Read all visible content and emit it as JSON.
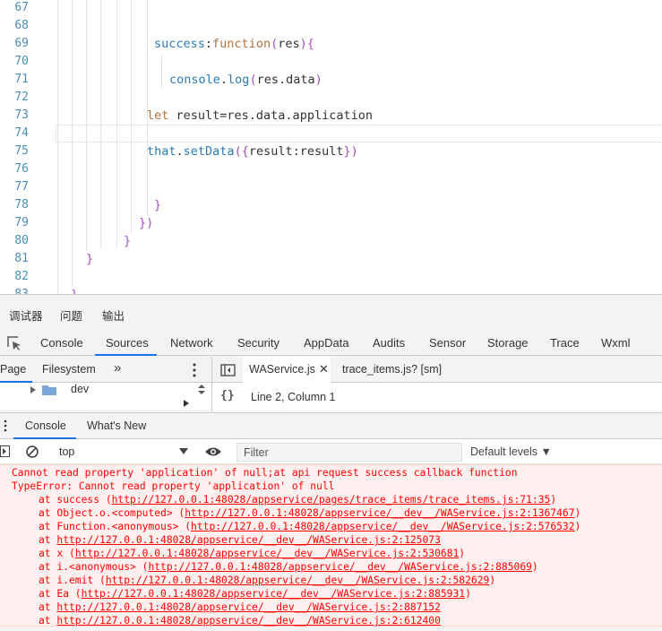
{
  "editor": {
    "lines": [
      {
        "num": "67",
        "code": ""
      },
      {
        "num": "68",
        "code": ""
      },
      {
        "num": "69",
        "code": "success:function(res){"
      },
      {
        "num": "70",
        "code": ""
      },
      {
        "num": "71",
        "code": "console.log(res.data)"
      },
      {
        "num": "72",
        "code": ""
      },
      {
        "num": "73",
        "code": "let result=res.data.application"
      },
      {
        "num": "74",
        "code": ""
      },
      {
        "num": "75",
        "code": "that.setData({result:result})"
      },
      {
        "num": "76",
        "code": ""
      },
      {
        "num": "77",
        "code": ""
      },
      {
        "num": "78",
        "code": "}"
      },
      {
        "num": "79",
        "code": "})"
      },
      {
        "num": "80",
        "code": "}"
      },
      {
        "num": "81",
        "code": "}"
      },
      {
        "num": "82",
        "code": ""
      },
      {
        "num": "83",
        "code": "}"
      }
    ]
  },
  "devtools": {
    "main_tabs": [
      "调试器",
      "问题",
      "输出"
    ],
    "panel_tabs": [
      "Console",
      "Sources",
      "Network",
      "Security",
      "AppData",
      "Audits",
      "Sensor",
      "Storage",
      "Trace",
      "Wxml"
    ],
    "active_panel": "Sources",
    "navigator_tabs": [
      "Page",
      "Filesystem",
      "»"
    ],
    "file_tabs": [
      "WAService.js",
      "trace_items.js? [sm]"
    ],
    "tree_item": "dev",
    "status": "Line 2, Column 1",
    "drawer_tabs": [
      "Console",
      "What's New"
    ],
    "context": "top",
    "filter_placeholder": "Filter",
    "levels": "Default levels ▼",
    "error": {
      "message": "Cannot read property 'application' of null;at api request success callback function",
      "type": "TypeError: Cannot read property 'application' of null",
      "stack": [
        {
          "prefix": "at success (",
          "link": "http://127.0.0.1:48028/appservice/pages/trace_items/trace_items.js:71:35",
          "suffix": ")"
        },
        {
          "prefix": "at Object.o.<computed> (",
          "link": "http://127.0.0.1:48028/appservice/__dev__/WAService.js:2:1367467",
          "suffix": ")"
        },
        {
          "prefix": "at Function.<anonymous> (",
          "link": "http://127.0.0.1:48028/appservice/__dev__/WAService.js:2:576532",
          "suffix": ")"
        },
        {
          "prefix": "at ",
          "link": "http://127.0.0.1:48028/appservice/__dev__/WAService.js:2:125073",
          "suffix": ""
        },
        {
          "prefix": "at x (",
          "link": "http://127.0.0.1:48028/appservice/__dev__/WAService.js:2:530681",
          "suffix": ")"
        },
        {
          "prefix": "at i.<anonymous> (",
          "link": "http://127.0.0.1:48028/appservice/__dev__/WAService.js:2:885069",
          "suffix": ")"
        },
        {
          "prefix": "at i.emit (",
          "link": "http://127.0.0.1:48028/appservice/__dev__/WAService.js:2:582629",
          "suffix": ")"
        },
        {
          "prefix": "at Ea (",
          "link": "http://127.0.0.1:48028/appservice/__dev__/WAService.js:2:885931",
          "suffix": ")"
        },
        {
          "prefix": "at ",
          "link": "http://127.0.0.1:48028/appservice/__dev__/WAService.js:2:887152",
          "suffix": ""
        },
        {
          "prefix": "at ",
          "link": "http://127.0.0.1:48028/appservice/__dev__/WAService.js:2:612400",
          "suffix": ""
        }
      ]
    }
  },
  "colors": {
    "accent": "#1a73e8",
    "error_text": "#ff0000",
    "error_bg": "#fff0f0",
    "line_number": "#4a8eb6"
  }
}
